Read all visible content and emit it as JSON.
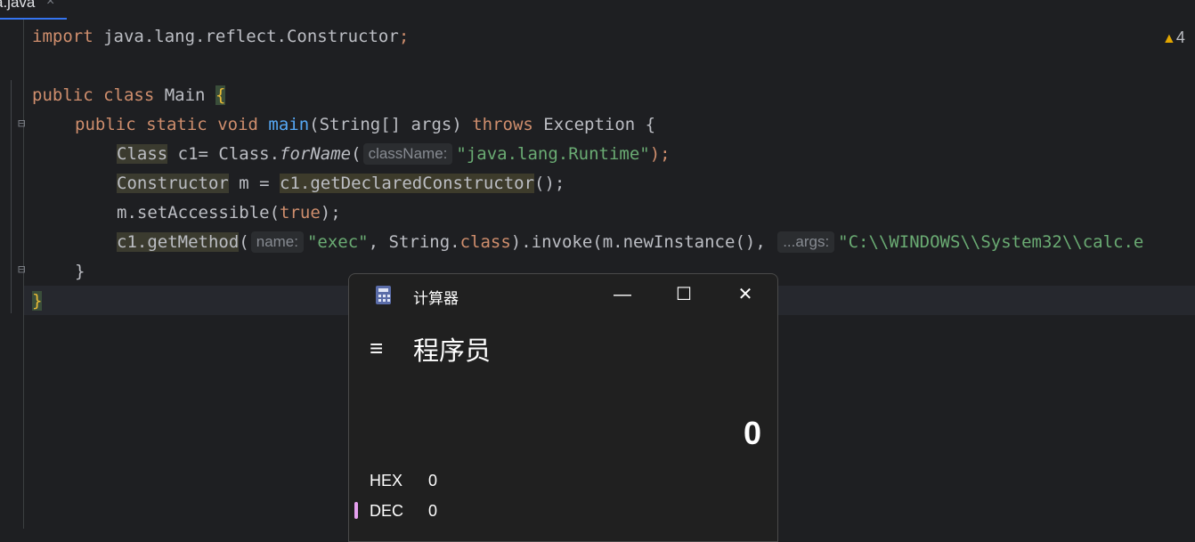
{
  "tab": {
    "filename": "a.java",
    "close": "×"
  },
  "editor": {
    "warning_count": "4",
    "line1": {
      "import": "import",
      "path": " java.lang.reflect.Constructor",
      "semi": ";"
    },
    "line3": {
      "public": "public",
      "class": "class",
      "name": " Main ",
      "brace": "{"
    },
    "line4": {
      "public": "public",
      "static": "static",
      "void": "void",
      "main": "main",
      "params": "(String[] args) ",
      "throws": "throws",
      "rest": " Exception {"
    },
    "line5": {
      "type": "Class",
      "decl": " c1= Class.",
      "forName": "forName",
      "open": "(",
      "hint": "className:",
      "str": "\"java.lang.Runtime\"",
      "close": ");"
    },
    "line6": {
      "type": "Constructor",
      "decl": " m = ",
      "call": "c1.getDeclaredConstructor",
      "close": "();"
    },
    "line7": {
      "call": "m.setAccessible(",
      "true": "true",
      "close": ");"
    },
    "line8": {
      "call": "c1.getMethod",
      "open": "(",
      "hint1": "name:",
      "str1": "\"exec\"",
      "comma": ", String.",
      "class": "class",
      "rest": ").invoke(m.newInstance(), ",
      "hint2": "...args:",
      "str2": "\"C:\\\\WINDOWS\\\\System32\\\\calc.e"
    },
    "line9": {
      "brace": "}"
    },
    "line10": {
      "brace": "}"
    }
  },
  "calculator": {
    "title": "计算器",
    "minimize": "—",
    "maximize": "☐",
    "close": "✕",
    "menu_icon": "≡",
    "mode": "程序员",
    "display": "0",
    "hex_label": "HEX",
    "hex_value": "0",
    "dec_label": "DEC",
    "dec_value": "0"
  },
  "colors": {
    "accent": "#e6a0ef",
    "keyword": "#cf8e6d",
    "string": "#6aab73"
  }
}
